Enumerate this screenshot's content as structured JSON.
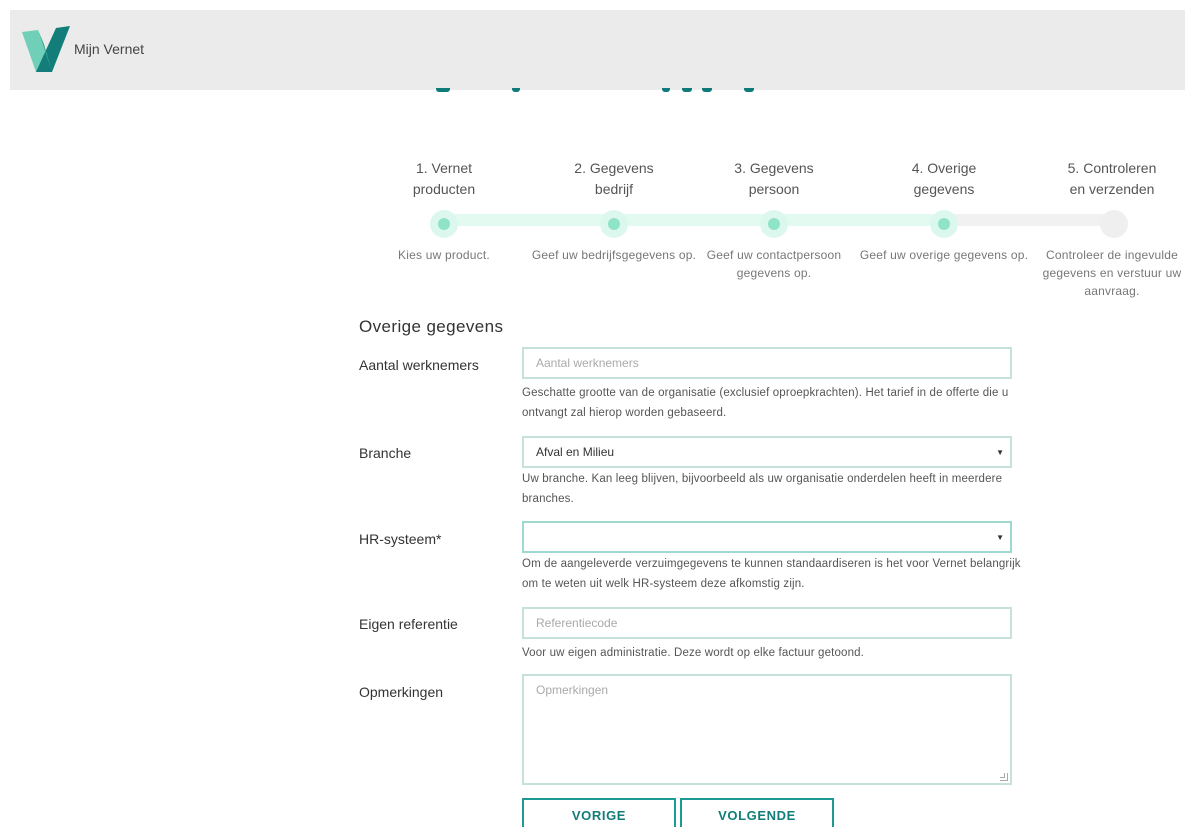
{
  "header": {
    "brand": "Mijn Vernet"
  },
  "steps": [
    {
      "title_line1": "1. Vernet",
      "title_line2": "producten",
      "desc": "Kies uw product.",
      "state": "done"
    },
    {
      "title_line1": "2. Gegevens",
      "title_line2": "bedrijf",
      "desc": "Geef uw bedrijfsgegevens op.",
      "state": "done"
    },
    {
      "title_line1": "3. Gegevens",
      "title_line2": "persoon",
      "desc": "Geef uw contactpersoon gegevens op.",
      "state": "done"
    },
    {
      "title_line1": "4. Overige",
      "title_line2": "gegevens",
      "desc": "Geef uw overige gegevens op.",
      "state": "current"
    },
    {
      "title_line1": "5. Controleren",
      "title_line2": "en verzenden",
      "desc": "Controleer de ingevulde gegevens en verstuur uw aanvraag.",
      "state": "todo"
    }
  ],
  "form": {
    "section_title": "Overige gegevens",
    "employees": {
      "label": "Aantal werknemers",
      "placeholder": "Aantal werknemers",
      "help": "Geschatte grootte van de organisatie (exclusief oproepkrachten). Het tarief in de offerte die u ontvangt zal hierop worden gebaseerd."
    },
    "branche": {
      "label": "Branche",
      "value": "Afval en Milieu",
      "help": "Uw branche. Kan leeg blijven, bijvoorbeeld als uw organisatie onderdelen heeft in meerdere branches."
    },
    "hr_system": {
      "label": "HR-systeem*",
      "value": "",
      "help": "Om de aangeleverde verzuimgegevens te kunnen standaardiseren is het voor Vernet belangrijk om te weten uit welk HR-systeem deze afkomstig zijn."
    },
    "reference": {
      "label": "Eigen referentie",
      "placeholder": "Referentiecode",
      "help": "Voor uw eigen administratie. Deze wordt op elke factuur getoond."
    },
    "remarks": {
      "label": "Opmerkingen",
      "placeholder": "Opmerkingen"
    }
  },
  "buttons": {
    "previous": "VORIGE",
    "next": "VOLGENDE"
  },
  "colors": {
    "accent": "#1d9a95",
    "progress_done": "#8fe3c8",
    "header_bg": "#ebebeb"
  }
}
